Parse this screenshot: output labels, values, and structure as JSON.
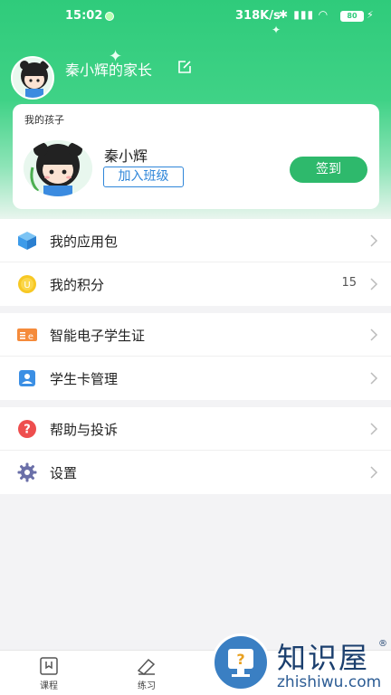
{
  "status_bar": {
    "time": "15:02",
    "network_speed": "318K/s",
    "battery": "80"
  },
  "profile": {
    "parent_name": "秦小辉的家长"
  },
  "child_card": {
    "section_label": "我的孩子",
    "child_name": "秦小辉",
    "join_class_label": "加入班级",
    "checkin_label": "签到"
  },
  "menu_groups": [
    {
      "items": [
        {
          "label": "我的应用包",
          "icon": "app-package-icon",
          "value": ""
        },
        {
          "label": "我的积分",
          "icon": "points-coin-icon",
          "value": "15"
        }
      ]
    },
    {
      "items": [
        {
          "label": "智能电子学生证",
          "icon": "e-student-card-icon",
          "value": ""
        },
        {
          "label": "学生卡管理",
          "icon": "student-card-icon",
          "value": ""
        }
      ]
    },
    {
      "items": [
        {
          "label": "帮助与投诉",
          "icon": "help-icon",
          "value": ""
        },
        {
          "label": "设置",
          "icon": "settings-gear-icon",
          "value": ""
        }
      ]
    }
  ],
  "bottom_nav": [
    {
      "label": "课程",
      "icon": "course-icon"
    },
    {
      "label": "练习",
      "icon": "practice-icon"
    }
  ],
  "watermark": {
    "title": "知识屋",
    "subtitle": "zhishiwu.com",
    "mark": "®"
  },
  "colors": {
    "header_green": "#2fcb7b",
    "checkin_green": "#2eb96c",
    "link_blue": "#2f86d9"
  }
}
